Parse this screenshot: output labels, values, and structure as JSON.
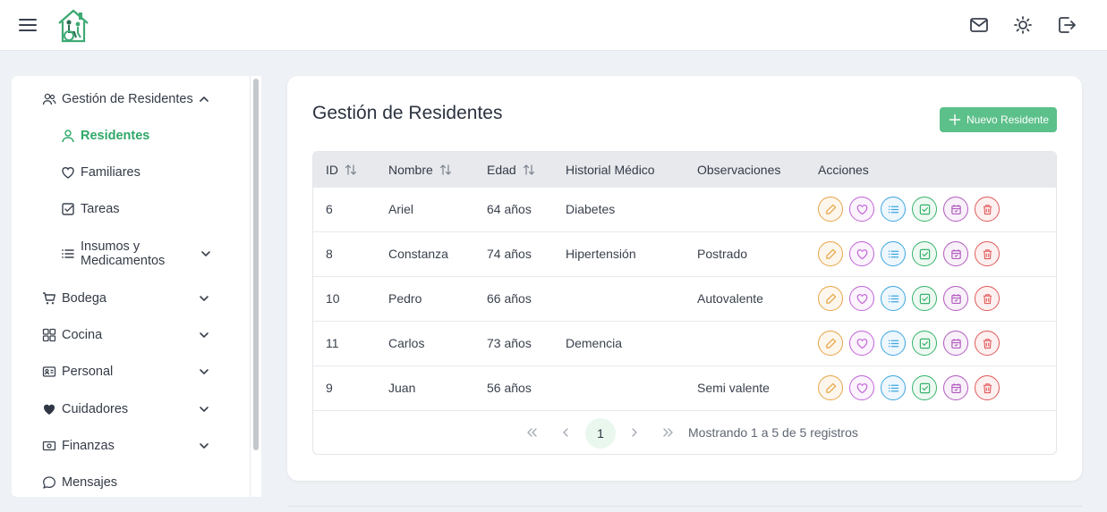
{
  "colors": {
    "accent": "#2fa868",
    "button": "#5cc08a",
    "edit": "#e7a547",
    "favorite": "#c265d6",
    "list": "#3ea6e0",
    "check": "#37b36e",
    "calendar": "#b25bbf",
    "delete": "#e05a5a"
  },
  "header": {
    "icons": [
      "menu-icon",
      "logo",
      "mail-icon",
      "sun-icon",
      "logout-icon"
    ]
  },
  "sidebar": {
    "group": {
      "label": "Gestión de Residentes",
      "icon": "users-icon"
    },
    "subitems": [
      {
        "label": "Residentes",
        "icon": "user-icon",
        "active": true
      },
      {
        "label": "Familiares",
        "icon": "heart-icon"
      },
      {
        "label": "Tareas",
        "icon": "checkbox-icon"
      },
      {
        "label_line1": "Insumos y",
        "label_line2": "Medicamentos",
        "icon": "list-icon"
      }
    ],
    "items": [
      {
        "label": "Bodega",
        "icon": "cart-icon"
      },
      {
        "label": "Cocina",
        "icon": "grid-icon"
      },
      {
        "label": "Personal",
        "icon": "id-card-icon"
      },
      {
        "label": "Cuidadores",
        "icon": "heart-filled-icon"
      },
      {
        "label": "Finanzas",
        "icon": "money-icon"
      },
      {
        "label": "Mensajes",
        "icon": "chat-icon"
      }
    ]
  },
  "main": {
    "title": "Gestión de Residentes",
    "new_button": "Nuevo Residente",
    "table": {
      "headers": [
        "ID",
        "Nombre",
        "Edad",
        "Historial Médico",
        "Observaciones",
        "Acciones"
      ],
      "rows": [
        {
          "id": "6",
          "nombre": "Ariel",
          "edad": "64 años",
          "historial": "Diabetes",
          "observaciones": ""
        },
        {
          "id": "8",
          "nombre": "Constanza",
          "edad": "74 años",
          "historial": "Hipertensión",
          "observaciones": "Postrado"
        },
        {
          "id": "10",
          "nombre": "Pedro",
          "edad": "66 años",
          "historial": "",
          "observaciones": "Autovalente"
        },
        {
          "id": "11",
          "nombre": "Carlos",
          "edad": "73 años",
          "historial": "Demencia",
          "observaciones": ""
        },
        {
          "id": "9",
          "nombre": "Juan",
          "edad": "56 años",
          "historial": "",
          "observaciones": "Semi valente"
        }
      ],
      "action_icons": [
        "edit-icon",
        "heart-icon",
        "list-icon",
        "check-icon",
        "calendar-icon",
        "trash-icon"
      ]
    },
    "pagination": {
      "current_page": "1",
      "info": "Mostrando 1 a 5 de 5 registros"
    }
  }
}
